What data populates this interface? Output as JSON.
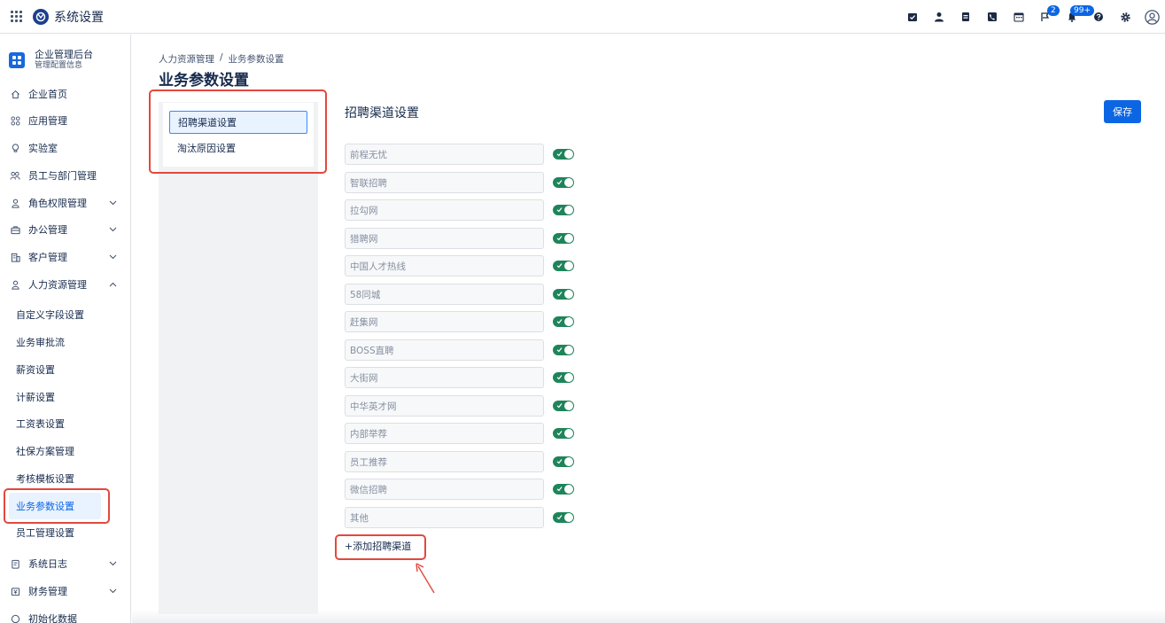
{
  "app": {
    "title": "系统设置",
    "badges": {
      "flag_count": "2",
      "notifications_count": "99+"
    }
  },
  "sidebar": {
    "org_name": "企业管理后台",
    "org_subtitle": "管理配置信息",
    "items": [
      {
        "label": "企业首页",
        "icon": "home-icon"
      },
      {
        "label": "应用管理",
        "icon": "apps-icon"
      },
      {
        "label": "实验室",
        "icon": "lightbulb-icon"
      },
      {
        "label": "员工与部门管理",
        "icon": "people-icon"
      },
      {
        "label": "角色权限管理",
        "icon": "person-icon"
      },
      {
        "label": "办公管理",
        "icon": "briefcase-icon"
      },
      {
        "label": "客户管理",
        "icon": "building-icon"
      },
      {
        "label": "人力资源管理",
        "icon": "person-icon"
      }
    ],
    "hr_subitems": [
      "自定义字段设置",
      "业务审批流",
      "薪资设置",
      "计薪设置",
      "工资表设置",
      "社保方案管理",
      "考核模板设置",
      "业务参数设置",
      "员工管理设置"
    ],
    "bottom_items": [
      {
        "label": "系统日志",
        "icon": "log-icon"
      },
      {
        "label": "财务管理",
        "icon": "finance-icon"
      },
      {
        "label": "初始化数据",
        "icon": "data-icon"
      }
    ]
  },
  "breadcrumb": {
    "parent": "人力资源管理",
    "separator": "/",
    "current": "业务参数设置"
  },
  "page_title": "业务参数设置",
  "panel": {
    "items": [
      "招聘渠道设置",
      "淘汰原因设置"
    ]
  },
  "section": {
    "title": "招聘渠道设置",
    "save_label": "保存",
    "add_label": "+添加招聘渠道",
    "channels": [
      "前程无忧",
      "智联招聘",
      "拉勾网",
      "猎聘网",
      "中国人才热线",
      "58同城",
      "赶集网",
      "BOSS直聘",
      "大街网",
      "中华英才网",
      "内部举荐",
      "员工推荐",
      "微信招聘",
      "其他"
    ]
  },
  "colors": {
    "accent": "#0c66e4",
    "toggle_on": "#1f845a",
    "highlight": "#e2483d"
  }
}
